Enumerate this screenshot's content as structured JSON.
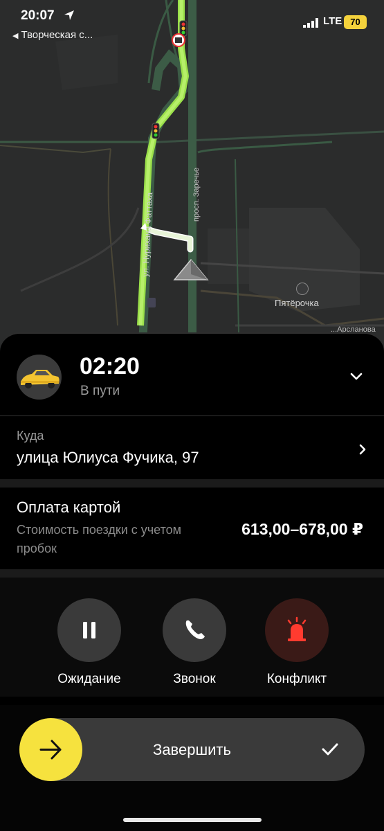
{
  "status_bar": {
    "time": "20:07",
    "location_icon": "location-arrow-icon",
    "back_text": "Творческая с...",
    "network": "LTE",
    "battery": "70"
  },
  "map": {
    "street_main": "ул. Нурихана Фаттаха",
    "street_secondary": "просп. Заречье",
    "street_right": "...Арсланова",
    "poi_name": "Пятёрочка",
    "poi_icon": "shop-basket-icon",
    "route_color": "#9be04a"
  },
  "ride": {
    "eta": "02:20",
    "status": "В пути",
    "car_icon": "taxi-car-icon",
    "collapse_icon": "chevron-down-icon"
  },
  "destination": {
    "label": "Куда",
    "address": "улица Юлиуса Фучика, 97"
  },
  "payment": {
    "title": "Оплата картой",
    "subtitle": "Стоимость поездки с учетом пробок",
    "price": "613,00–678,00 ₽"
  },
  "actions": [
    {
      "label": "Ожидание",
      "icon": "pause-icon",
      "bg": "#3a3a3a"
    },
    {
      "label": "Звонок",
      "icon": "phone-icon",
      "bg": "#3a3a3a"
    },
    {
      "label": "Конфликт",
      "icon": "siren-icon",
      "bg": "#3a1a17",
      "accent": "#ff3b2f"
    }
  ],
  "complete": {
    "label": "Завершить",
    "knob_color": "#f6e23e",
    "arrow_icon": "arrow-right-icon",
    "check_icon": "checkmark-icon"
  }
}
